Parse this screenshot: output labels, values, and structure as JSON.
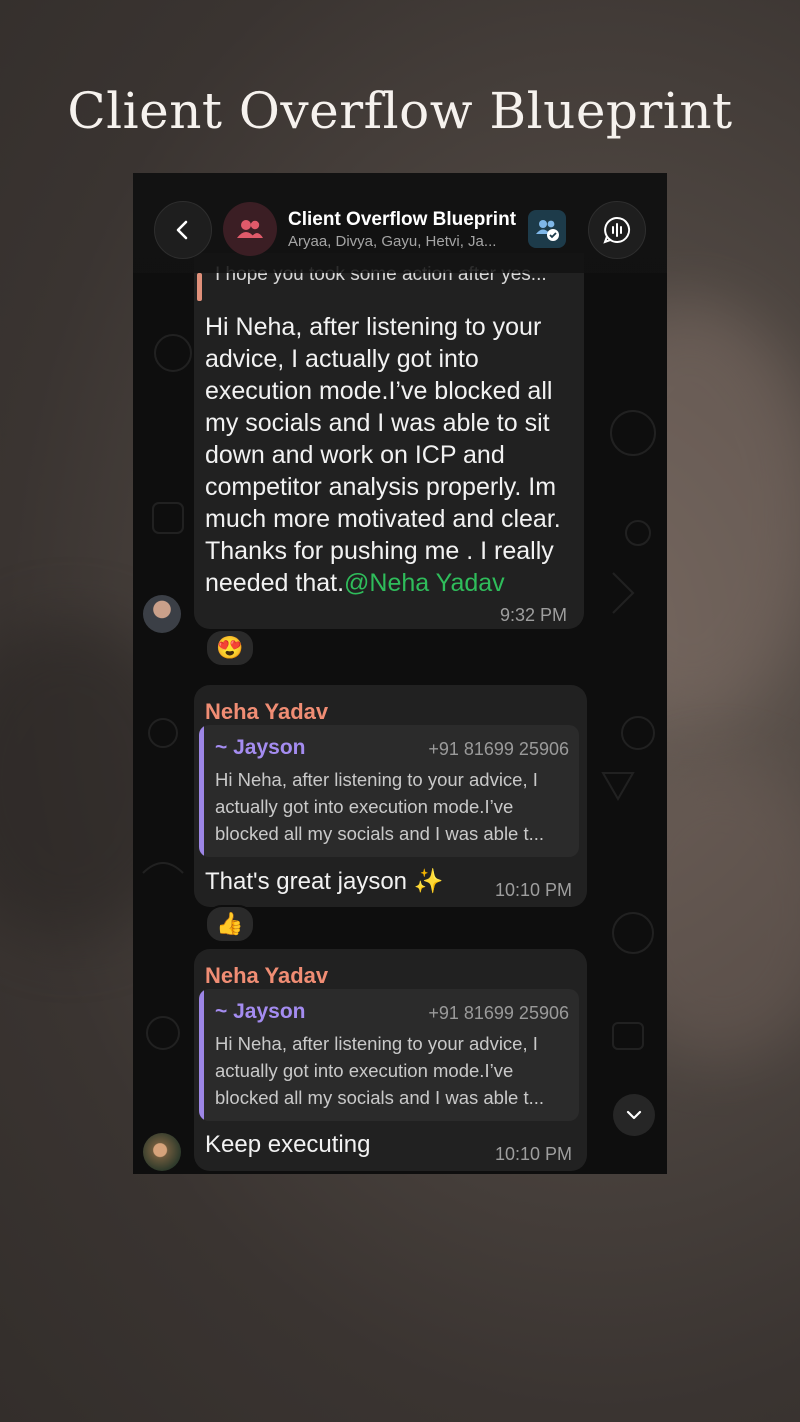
{
  "page": {
    "title": "Client Overflow Blueprint"
  },
  "header": {
    "back_icon": "chevron-left-icon",
    "group_icon": "group-icon",
    "title": "Client Overflow Blueprint",
    "members": "Aryaa, Divya, Gayu, Hetvi, Ja...",
    "community_icon": "community-icon",
    "voice_icon": "voice-chat-icon",
    "accent": "#e05a6a"
  },
  "messages": [
    {
      "quote_preview": "I hope you took some action after yes...",
      "text": "Hi Neha, after listening to your advice, I actually got into execution mode.I’ve blocked all my socials and I was able to sit down and work on ICP and competitor analysis properly. Im much more motivated and clear. Thanks for pushing me . I really needed that.",
      "mention": "@Neha Yadav",
      "time": "9:32 PM",
      "reaction": "😍"
    },
    {
      "sender": "Neha Yadav",
      "reply": {
        "name": "~ Jayson",
        "phone": "+91 81699 25906",
        "text": "Hi Neha, after listening to your advice, I actually got into execution mode.I’ve blocked all my socials and I was able t..."
      },
      "text": "That's great jayson ✨",
      "time": "10:10 PM",
      "reaction": "👍"
    },
    {
      "sender": "Neha Yadav",
      "reply": {
        "name": "~ Jayson",
        "phone": "+91 81699 25906",
        "text": "Hi Neha, after listening to your advice, I actually got into execution mode.I’ve blocked all my socials and I was able t..."
      },
      "text": "Keep executing",
      "time": "10:10 PM"
    }
  ],
  "scroll_down_icon": "chevron-down-icon",
  "colors": {
    "sender": "#f08d74",
    "reply_name": "#a48cf0",
    "mention": "#2fbd5b",
    "bubble": "#212121"
  }
}
